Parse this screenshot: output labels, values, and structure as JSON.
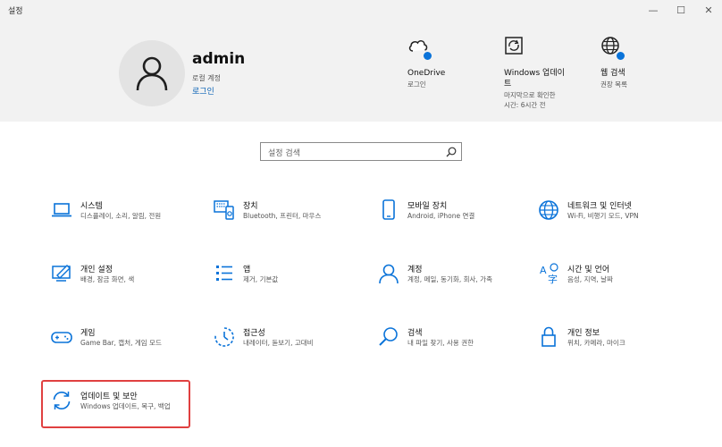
{
  "window": {
    "title": "설정",
    "minimize": "—",
    "maximize": "☐",
    "close": "✕"
  },
  "account": {
    "name": "admin",
    "type": "로컬 계정",
    "login_link": "로그인"
  },
  "header_items": [
    {
      "title": "OneDrive",
      "sub": "로그인",
      "icon": "cloud-icon"
    },
    {
      "title_line1": "Windows 업데이",
      "title_line2": "트",
      "sub_line1": "마지막으로 확인한",
      "sub_line2": "시간: 6시간 전",
      "icon": "windows-update-icon"
    },
    {
      "title": "웹 검색",
      "sub": "권장 목록",
      "icon": "globe-icon"
    }
  ],
  "search": {
    "placeholder": "설정 검색"
  },
  "categories": [
    {
      "title": "시스템",
      "sub": "디스플레이, 소리, 알림, 전원",
      "icon": "laptop-icon"
    },
    {
      "title": "장치",
      "sub": "Bluetooth, 프린터, 마우스",
      "icon": "devices-icon"
    },
    {
      "title": "모바일 장치",
      "sub": "Android, iPhone 연결",
      "icon": "phone-icon"
    },
    {
      "title": "네트워크 및 인터넷",
      "sub": "Wi-Fi, 비행기 모드, VPN",
      "icon": "globe-icon"
    },
    {
      "title": "개인 설정",
      "sub": "배경, 잠금 화면, 색",
      "icon": "personalization-icon"
    },
    {
      "title": "앱",
      "sub": "제거, 기본값",
      "icon": "apps-icon"
    },
    {
      "title": "계정",
      "sub": "계정, 메일, 동기화, 회사, 가족",
      "icon": "person-icon"
    },
    {
      "title": "시간 및 언어",
      "sub": "음성, 지역, 날짜",
      "icon": "time-language-icon"
    },
    {
      "title": "게임",
      "sub": "Game Bar, 캡처, 게임 모드",
      "icon": "gamepad-icon"
    },
    {
      "title": "접근성",
      "sub": "내레이터, 돋보기, 고대비",
      "icon": "accessibility-icon"
    },
    {
      "title": "검색",
      "sub": "내 파일 찾기, 사용 권한",
      "icon": "search-icon"
    },
    {
      "title": "개인 정보",
      "sub": "위치, 카메라, 마이크",
      "icon": "lock-icon"
    },
    {
      "title": "업데이트 및 보안",
      "sub": "Windows 업데이트, 복구, 백업",
      "icon": "update-icon"
    }
  ],
  "colors": {
    "accent": "#0a73d9",
    "highlight_border": "#e04040",
    "header_bg": "#f2f2f2"
  }
}
